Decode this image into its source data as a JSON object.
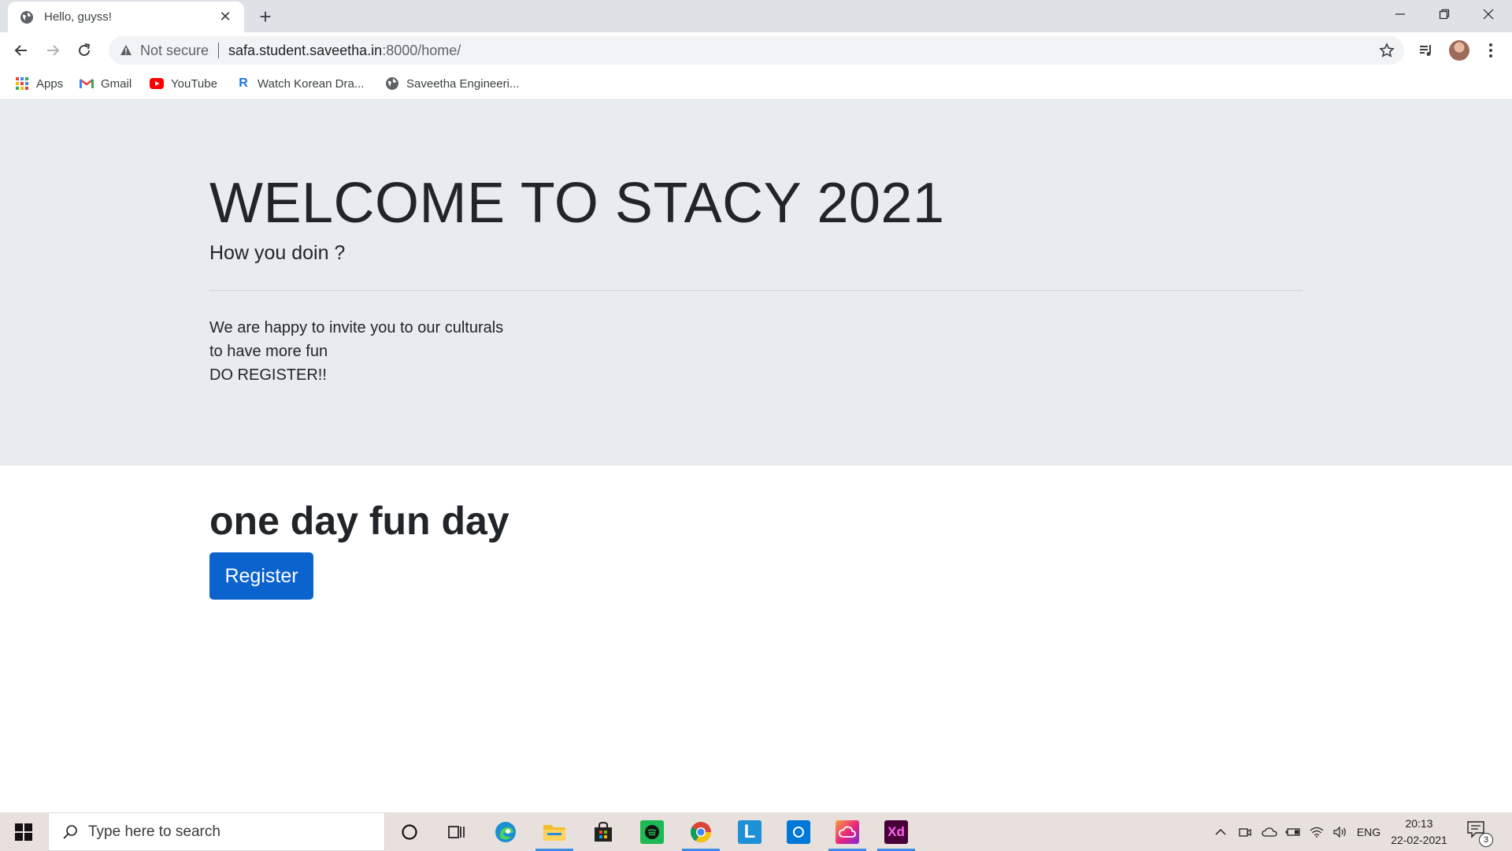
{
  "browser": {
    "tab_title": "Hello, guyss!",
    "tab_close": "✕",
    "new_tab": "+",
    "security_label": "Not secure",
    "url_host": "safa.student.saveetha.in",
    "url_path": ":8000/home/",
    "window_controls": [
      "minimize",
      "restore",
      "close"
    ]
  },
  "bookmarks": [
    {
      "label": "Apps",
      "icon": "apps-grid-icon"
    },
    {
      "label": "Gmail",
      "icon": "gmail-icon"
    },
    {
      "label": "YouTube",
      "icon": "youtube-icon"
    },
    {
      "label": "Watch Korean Dra...",
      "icon": "r-site-icon"
    },
    {
      "label": "Saveetha Engineeri...",
      "icon": "globe-icon"
    }
  ],
  "page": {
    "heading": "WELCOME TO STACY 2021",
    "lead": "How you doin ?",
    "paragraph_lines": [
      "We are happy to invite you to our culturals",
      "to have more fun",
      "DO REGISTER!!"
    ],
    "section_heading": "one day fun day",
    "register_label": "Register"
  },
  "colors": {
    "jumbotron_bg": "#e9ecef",
    "button_bg": "#0b63ce",
    "tabstrip_bg": "#dee1e6"
  },
  "taskbar": {
    "search_placeholder": "Type here to search",
    "apps": [
      "cortana",
      "task-view",
      "edge",
      "file-explorer",
      "store",
      "spotify",
      "chrome",
      "l-app",
      "cortana-app",
      "creative-cloud",
      "adobe-xd"
    ],
    "xd_label": "Xd",
    "l_label": "L",
    "language": "ENG",
    "time": "20:13",
    "date": "22-02-2021",
    "notification_count": "3"
  }
}
